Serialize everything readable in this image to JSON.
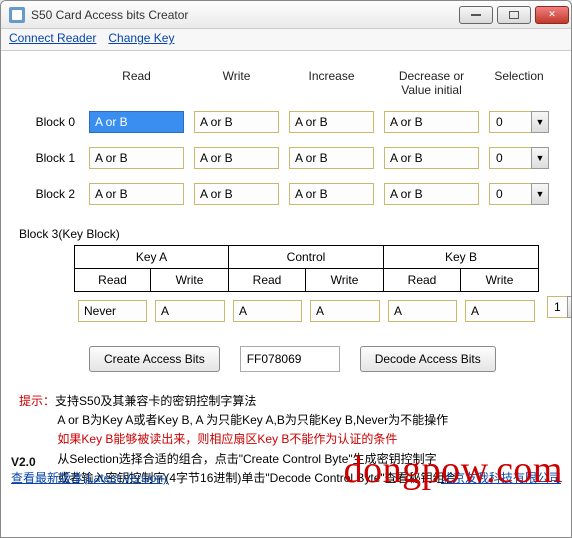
{
  "window": {
    "title": "S50 Card Access bits Creator"
  },
  "menu": {
    "connectReader": "Connect Reader",
    "changeKey": "Change Key"
  },
  "columns": {
    "read": "Read",
    "write": "Write",
    "increase": "Increase",
    "decrease": "Decrease or Value initial",
    "selection": "Selection"
  },
  "blocks": [
    {
      "label": "Block 0",
      "read": "A or B",
      "write": "A or B",
      "increase": "A or B",
      "decrease": "A or B",
      "selection": "0",
      "selected": true
    },
    {
      "label": "Block 1",
      "read": "A or B",
      "write": "A or B",
      "increase": "A or B",
      "decrease": "A or B",
      "selection": "0"
    },
    {
      "label": "Block 2",
      "read": "A or B",
      "write": "A or B",
      "increase": "A or B",
      "decrease": "A or B",
      "selection": "0"
    }
  ],
  "block3": {
    "title": "Block 3(Key Block)",
    "groups": {
      "keyA": "Key A",
      "control": "Control",
      "keyB": "Key B"
    },
    "subcols": {
      "read": "Read",
      "write": "Write"
    },
    "values": {
      "keyA_read": "Never",
      "keyA_write": "A",
      "ctrl_read": "A",
      "ctrl_write": "A",
      "keyB_read": "A",
      "keyB_write": "A"
    },
    "selection": "1"
  },
  "actions": {
    "createBtn": "Create Access Bits",
    "hexValue": "FF078069",
    "decodeBtn": "Decode Access Bits"
  },
  "help": {
    "label": "提示：",
    "line1": "支持S50及其兼容卡的密钥控制字算法",
    "line2": "A or B为Key A或者Key B, A 为只能Key A,B为只能Key B,Never为不能操作",
    "line3": "如果Key B能够被读出来，则相应扇区Key B不能作为认证的条件",
    "line4": "从Selection选择合适的组合，点击\"Create Control Byte\"生成密钥控制字",
    "line5": "或者输入密钥控制字(4字节16进制)单击\"Decode Control Byte\"查看秘钥组合"
  },
  "footer": {
    "version": "V2.0",
    "latestLink": "查看最新版本(Latest Version)",
    "credit": "北京友我科技有限公司"
  },
  "brand": "dongpow.com"
}
